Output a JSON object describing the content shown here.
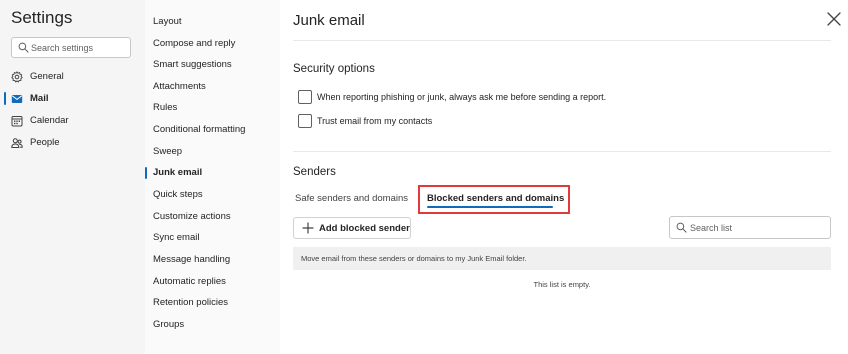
{
  "nav": {
    "title": "Settings",
    "search_placeholder": "Search settings",
    "items": [
      {
        "label": "General",
        "icon": "gear-icon"
      },
      {
        "label": "Mail",
        "icon": "mail-icon",
        "active": true
      },
      {
        "label": "Calendar",
        "icon": "calendar-icon"
      },
      {
        "label": "People",
        "icon": "people-icon"
      }
    ]
  },
  "subnav": {
    "items": [
      "Layout",
      "Compose and reply",
      "Smart suggestions",
      "Attachments",
      "Rules",
      "Conditional formatting",
      "Sweep",
      "Junk email",
      "Quick steps",
      "Customize actions",
      "Sync email",
      "Message handling",
      "Automatic replies",
      "Retention policies",
      "Groups"
    ],
    "active": "Junk email"
  },
  "main": {
    "title": "Junk email",
    "security": {
      "title": "Security options",
      "options": [
        {
          "label": "When reporting phishing or junk, always ask me before sending a report.",
          "checked": false
        },
        {
          "label": "Trust email from my contacts",
          "checked": false
        }
      ]
    },
    "senders": {
      "title": "Senders",
      "tabs": [
        {
          "label": "Safe senders and domains",
          "active": false
        },
        {
          "label": "Blocked senders and domains",
          "active": true
        }
      ],
      "add_button": "Add blocked sender",
      "search_placeholder": "Search list",
      "info": "Move email from these senders or domains to my Junk Email folder.",
      "empty_text": "This list is empty."
    }
  },
  "colors": {
    "accent": "#0f6cbd",
    "highlight": "#e03a3a",
    "nav_bg": "#f5f5f5",
    "subnav_bg": "#fafafa"
  }
}
